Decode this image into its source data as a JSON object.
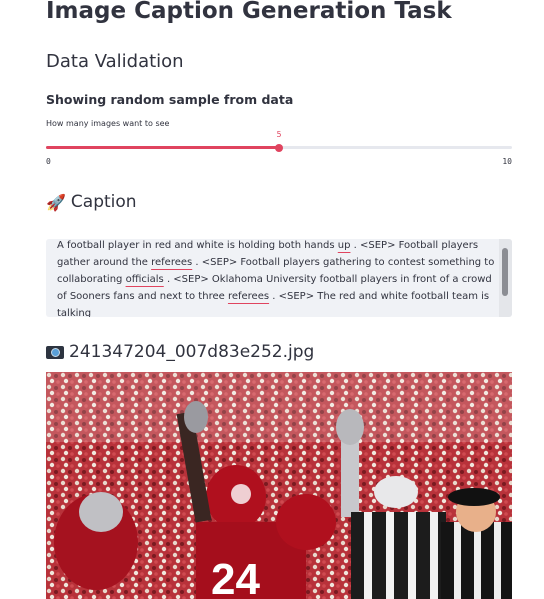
{
  "page": {
    "title": "Image Caption Generation Task",
    "section_title": "Data Validation",
    "subheader": "Showing random sample from data"
  },
  "slider": {
    "label": "How many images want to see",
    "value": "5",
    "min": "0",
    "max": "10",
    "accent": "#e0445f",
    "fraction": 0.5
  },
  "caption": {
    "icon": "rocket-icon",
    "title": "Caption",
    "text_parts": [
      "A football player in red and white is holding both hands ",
      "up",
      " . <SEP> Football players gather around the ",
      "referees",
      " . <SEP> Football players gathering to contest something to collaborating ",
      "officials",
      " . <SEP> Oklahoma University football players in front of a crowd of Sooners fans and next to three ",
      "referees",
      " . <SEP> The red and white football team is talking"
    ]
  },
  "image": {
    "icon": "camera-icon",
    "filename": "241347204_007d83e252.jpg"
  }
}
